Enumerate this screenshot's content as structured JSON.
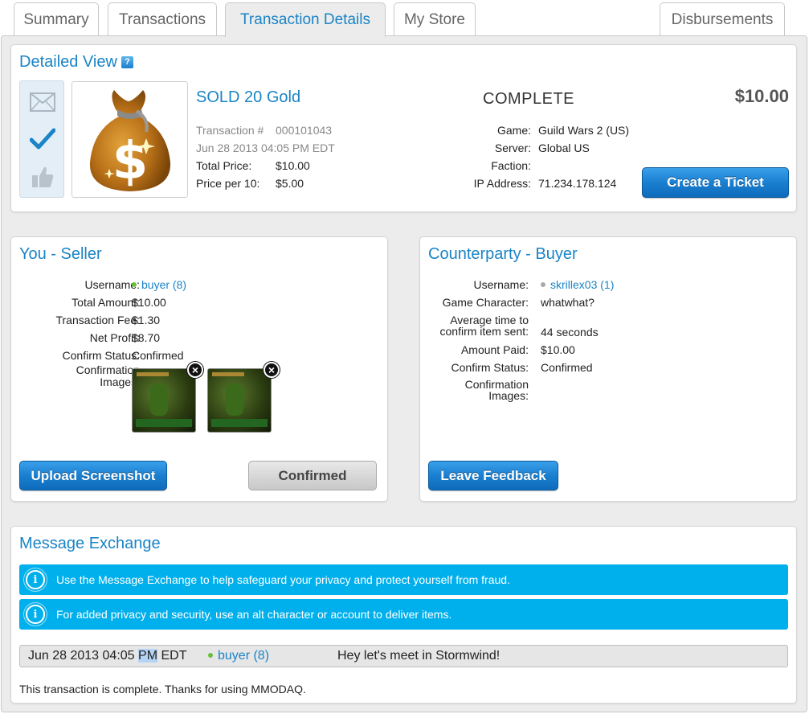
{
  "tabs": [
    {
      "label": "Summary",
      "active": false
    },
    {
      "label": "Transactions",
      "active": false
    },
    {
      "label": "Transaction Details",
      "active": true
    },
    {
      "label": "My Store",
      "active": false
    },
    {
      "label": "Disbursements",
      "active": false
    }
  ],
  "detailed_view": {
    "title": "Detailed View",
    "help_icon": "?",
    "status_icons": [
      "envelope-icon",
      "checkmark-icon",
      "thumbs-up-icon"
    ],
    "item_image": "money-bag-icon",
    "item_title": "SOLD 20 Gold",
    "transaction_label": "Transaction #",
    "transaction_number": "000101043",
    "date": "Jun 28 2013 04:05 PM EDT",
    "total_price_label": "Total Price:",
    "total_price": "$10.00",
    "price_per_label": "Price per 10:",
    "price_per": "$5.00",
    "status": "COMPLETE",
    "price": "$10.00",
    "game_label": "Game:",
    "game": "Guild Wars 2 (US)",
    "server_label": "Server:",
    "server": "Global US",
    "faction_label": "Faction:",
    "faction": "",
    "ip_label": "IP Address:",
    "ip": "71.234.178.124",
    "create_ticket": "Create a Ticket"
  },
  "seller": {
    "title": "You - Seller",
    "username_label": "Username:",
    "username": "buyer (8)",
    "total_amount_label": "Total Amount:",
    "total_amount": "$10.00",
    "fee_label": "Transaction Fee:",
    "fee": "$1.30",
    "net_profit_label": "Net Profit:",
    "net_profit": "$8.70",
    "confirm_status_label": "Confirm Status:",
    "confirm_status": "Confirmed",
    "confirmation_images_label_1": "Confirmation",
    "confirmation_images_label_2": "Images:",
    "upload_button": "Upload Screenshot",
    "confirmed_button": "Confirmed",
    "online_color": "#6abf3a"
  },
  "buyer": {
    "title": "Counterparty - Buyer",
    "username_label": "Username:",
    "username": "skrillex03 (1)",
    "character_label": "Game Character:",
    "character": "whatwhat?",
    "avg_time_label_1": "Average time to",
    "avg_time_label_2": "confirm item sent:",
    "avg_time": "44 seconds",
    "amount_paid_label": "Amount Paid:",
    "amount_paid": "$10.00",
    "confirm_status_label": "Confirm Status:",
    "confirm_status": "Confirmed",
    "confirmation_images_label_1": "Confirmation",
    "confirmation_images_label_2": "Images:",
    "leave_feedback": "Leave Feedback",
    "offline_color": "#aaaaaa"
  },
  "messages": {
    "title": "Message Exchange",
    "info_1": "Use the Message Exchange to help safeguard your privacy and protect yourself from fraud.",
    "info_2": "For added privacy and security, use an alt character or account to deliver items.",
    "row": {
      "date_a": "Jun 28 2013 04:05 ",
      "date_hl": "PM",
      "date_b": " EDT",
      "user": "buyer (8)",
      "text": "Hey let's meet in Stormwind!"
    },
    "footer": "This transaction is complete. Thanks for using MMODAQ."
  }
}
